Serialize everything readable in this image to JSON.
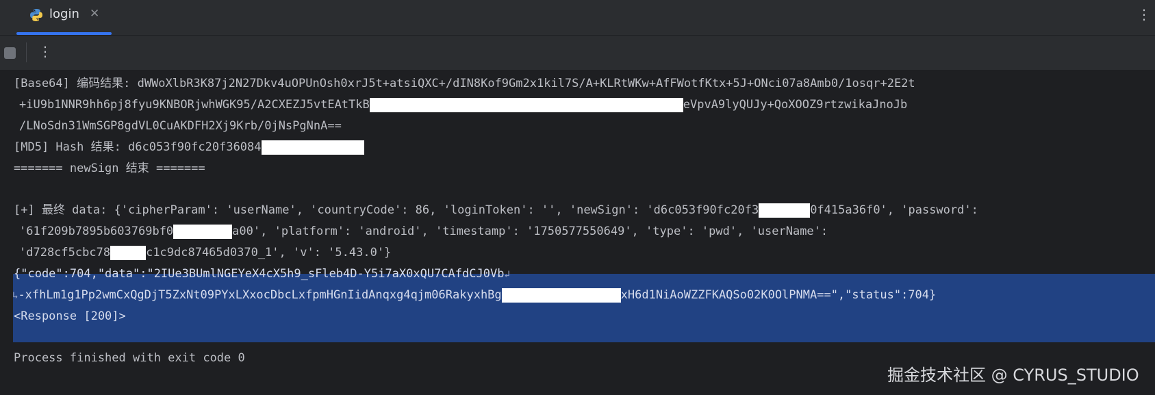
{
  "tabs": [
    {
      "label": "login",
      "icon": "python-file-icon",
      "active": true
    }
  ],
  "console": {
    "lines": [
      {
        "pre": "[Base64] 编码结果: dWWoXlbR3K87j2N27Dkv4uOPUnOsh0xrJ5t+atsiQXC+/dIN8Kof9Gm2x1kil7S/A+KLRtWKw+AfFWotfKtx+5J+ONci07a8Amb0/1osqr+2E2t",
        "post": ""
      },
      {
        "pre": "+iU9b1NNR9hh6pj8fyu9KNBORjwhWGK95/A2CXEZJ5vtEAtTkB",
        "post": "eVpvA9lyQUJy+QoXOOZ9rtzwikaJnoJb"
      },
      {
        "pre": "/LNoSdn31WmSGP8gdVL0CuAKDFH2Xj9Krb/0jNsPgNnA==",
        "post": ""
      },
      {
        "pre": "[MD5] Hash 结果: d6c053f90fc20f36084",
        "post": ""
      },
      {
        "pre": "======= newSign 结束 =======",
        "post": ""
      },
      {
        "pre": "[+] 最终 data: {'cipherParam': 'userName', 'countryCode': 86, 'loginToken': '', 'newSign': 'd6c053f90fc20f3",
        "post": "0f415a36f0', 'password':"
      },
      {
        "pre": "'61f209b7895b603769bf0",
        "post": "a00', 'platform': 'android', 'timestamp': '1750577550649', 'type': 'pwd', 'userName':"
      },
      {
        "pre": "'d728cf5cbc78",
        "post": "c1c9dc87465d0370_1', 'v': '5.43.0'}"
      },
      {
        "pre": "{\"code\":704,\"data\":\"2IUe3BUmlNGEYeX4cX5h9_sFleb4D-Y5i7aX0xQU7CAfdCJ0Vb",
        "post": ""
      },
      {
        "pre": "-xfhLm1g1Pp2wmCxQgDjT5ZxNt09PYxLXxocDbcLxfpmHGnIidAnqxg4qjm06RakyxhBg",
        "post": "xH6d1NiAoWZZFKAQSo02K0OlPNMA==\",\"status\":704}"
      },
      {
        "pre": "<Response [200]>",
        "post": ""
      },
      {
        "pre": "Process finished with exit code 0",
        "post": ""
      }
    ]
  },
  "watermark": "掘金技术社区 @ CYRUS_STUDIO",
  "colors": {
    "accent": "#3574f0",
    "selection": "#214283",
    "console_bg": "#1e1f22"
  }
}
